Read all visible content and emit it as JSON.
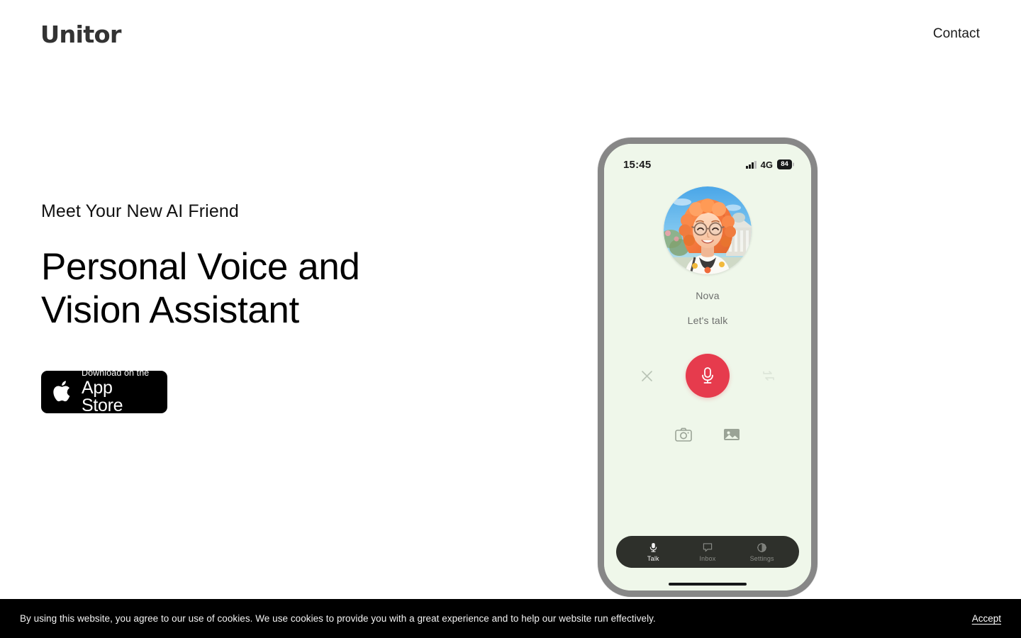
{
  "header": {
    "logo": "Unitor",
    "nav": [
      {
        "label": "Contact",
        "name": "nav-link-contact"
      }
    ]
  },
  "hero": {
    "eyebrow": "Meet Your New AI Friend",
    "headline": "Personal Voice and Vision Assistant",
    "appstore": {
      "small_label": "Download on the",
      "big_label": "App Store",
      "icon": "apple-logo-icon"
    }
  },
  "phone": {
    "status_bar": {
      "time": "15:45",
      "network": "4G",
      "battery": "84",
      "signal_icon": "signal-bars-icon",
      "battery_icon": "battery-icon"
    },
    "avatar": {
      "name": "avatar-image",
      "alt": "Illustrated portrait of a smiling woman with curly orange hair and glasses"
    },
    "assistant_name": "Nova",
    "assistant_status": "Let's talk",
    "controls": {
      "close_icon": "close-x-icon",
      "mic_icon": "microphone-icon",
      "swap_icon": "swap-arrows-icon"
    },
    "media": {
      "camera_icon": "camera-icon",
      "gallery_icon": "image-gallery-icon"
    },
    "bottom_nav": [
      {
        "label": "Talk",
        "icon": "microphone-icon",
        "active": true
      },
      {
        "label": "Inbox",
        "icon": "speech-bubble-icon",
        "active": false
      },
      {
        "label": "Settings",
        "icon": "gear-icon",
        "active": false
      }
    ]
  },
  "cookie_banner": {
    "text": "By using this website, you agree to our use of cookies. We use cookies to provide you with a great experience and to help our website run effectively.",
    "accept_label": "Accept"
  },
  "colors": {
    "accent_red": "#e63b4d",
    "phone_screen": "#eff7ea",
    "phone_frame": "#878787",
    "nav_pill": "#2e302b",
    "cookie_bg": "#000000"
  }
}
